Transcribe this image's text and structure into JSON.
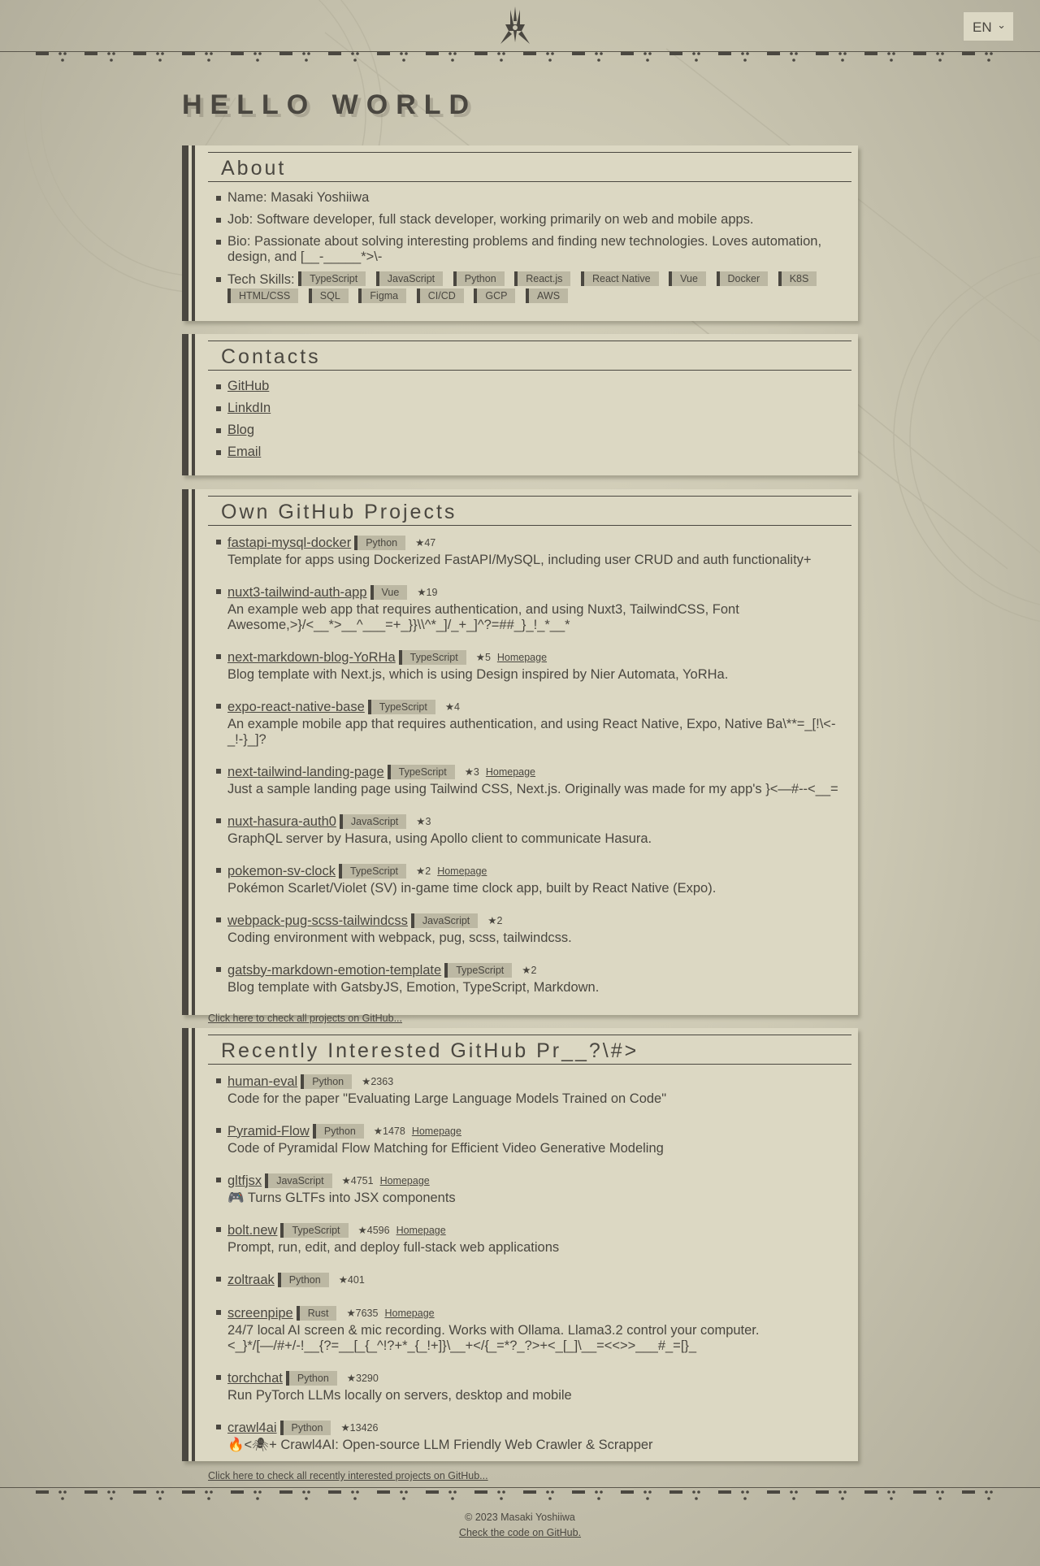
{
  "header": {
    "logo_icon": "yorha-logo-icon",
    "language": "EN"
  },
  "hero": {
    "title": "HELLO WORLD"
  },
  "about": {
    "title": "About",
    "name": "Name: Masaki Yoshiiwa",
    "job": "Job: Software developer, full stack developer, working primarily on web and mobile apps.",
    "bio": "Bio: Passionate about solving interesting problems and finding new technologies. Loves automation, design, and [__-_____*>\\-",
    "skills_label": "Tech Skills:",
    "skills": [
      "TypeScript",
      "JavaScript",
      "Python",
      "React.js",
      "React Native",
      "Vue",
      "Docker",
      "K8S",
      "HTML/CSS",
      "SQL",
      "Figma",
      "CI/CD",
      "GCP",
      "AWS"
    ]
  },
  "contacts": {
    "title": "Contacts",
    "links": [
      "GitHub",
      "LinkdIn",
      "Blog",
      "Email"
    ]
  },
  "own_projects": {
    "title": "Own GitHub Projects",
    "items": [
      {
        "name": "fastapi-mysql-docker",
        "lang": "Python",
        "stars": "47",
        "homepage": "",
        "desc": "Template for apps using Dockerized FastAPI/MySQL, including user CRUD and auth functionality+"
      },
      {
        "name": "nuxt3-tailwind-auth-app",
        "lang": "Vue",
        "stars": "19",
        "homepage": "",
        "desc": "An example web app that requires authentication, and using Nuxt3, TailwindCSS, Font Awesome,>}/<__*>__^___=+_}}\\\\^*_]/_+_]^?=##_}_!_*__*"
      },
      {
        "name": "next-markdown-blog-YoRHa",
        "lang": "TypeScript",
        "stars": "5",
        "homepage": "Homepage",
        "desc": "Blog template with Next.js, which is using Design inspired by Nier Automata, YoRHa."
      },
      {
        "name": "expo-react-native-base",
        "lang": "TypeScript",
        "stars": "4",
        "homepage": "",
        "desc": "An example mobile app that requires authentication, and using React Native, Expo, Native Ba\\**=_[!\\<-_!-}_]?"
      },
      {
        "name": "next-tailwind-landing-page",
        "lang": "TypeScript",
        "stars": "3",
        "homepage": "Homepage",
        "desc": "Just a sample landing page using Tailwind CSS, Next.js. Originally was made for my app's }<—#--<__="
      },
      {
        "name": "nuxt-hasura-auth0",
        "lang": "JavaScript",
        "stars": "3",
        "homepage": "",
        "desc": "GraphQL server by Hasura, using Apollo client to communicate Hasura."
      },
      {
        "name": "pokemon-sv-clock",
        "lang": "TypeScript",
        "stars": "2",
        "homepage": "Homepage",
        "desc": "Pokémon Scarlet/Violet (SV) in-game time clock app, built by React Native (Expo)."
      },
      {
        "name": "webpack-pug-scss-tailwindcss",
        "lang": "JavaScript",
        "stars": "2",
        "homepage": "",
        "desc": "Coding environment with webpack, pug, scss, tailwindcss."
      },
      {
        "name": "gatsby-markdown-emotion-template",
        "lang": "TypeScript",
        "stars": "2",
        "homepage": "",
        "desc": "Blog template with GatsbyJS, Emotion, TypeScript, Markdown."
      }
    ],
    "more_link": "Click here to check all projects on GitHub..."
  },
  "interested_projects": {
    "title": "Recently Interested GitHub Pr__?\\#>",
    "items": [
      {
        "name": "human-eval",
        "lang": "Python",
        "stars": "2363",
        "homepage": "",
        "desc": "Code for the paper \"Evaluating Large Language Models Trained on Code\""
      },
      {
        "name": "Pyramid-Flow",
        "lang": "Python",
        "stars": "1478",
        "homepage": "Homepage",
        "desc": "Code of Pyramidal Flow Matching for Efficient Video Generative Modeling"
      },
      {
        "name": "gltfjsx",
        "lang": "JavaScript",
        "stars": "4751",
        "homepage": "Homepage",
        "desc": "🎮 Turns GLTFs into JSX components"
      },
      {
        "name": "bolt.new",
        "lang": "TypeScript",
        "stars": "4596",
        "homepage": "Homepage",
        "desc": "Prompt, run, edit, and deploy full-stack web applications"
      },
      {
        "name": "zoltraak",
        "lang": "Python",
        "stars": "401",
        "homepage": "",
        "desc": ""
      },
      {
        "name": "screenpipe",
        "lang": "Rust",
        "stars": "7635",
        "homepage": "Homepage",
        "desc": "24/7 local AI screen & mic recording. Works with Ollama. Llama3.2 control your computer. <_}*/[—/#+/-!__{?=__[_{_^!?+*_{_!+]}\\__+</{_=*?_?>+<_[_]\\__=<<>>___#_=[}_"
      },
      {
        "name": "torchchat",
        "lang": "Python",
        "stars": "3290",
        "homepage": "",
        "desc": "Run PyTorch LLMs locally on servers, desktop and mobile"
      },
      {
        "name": "crawl4ai",
        "lang": "Python",
        "stars": "13426",
        "homepage": "",
        "desc": "🔥<🕷+ Crawl4AI: Open-source LLM Friendly Web Crawler & Scrapper"
      }
    ],
    "more_link": "Click here to check all recently interested projects on GitHub..."
  },
  "footer": {
    "copyright": "© 2023 Masaki Yoshiiwa",
    "code_link": "Check the code on GitHub."
  }
}
